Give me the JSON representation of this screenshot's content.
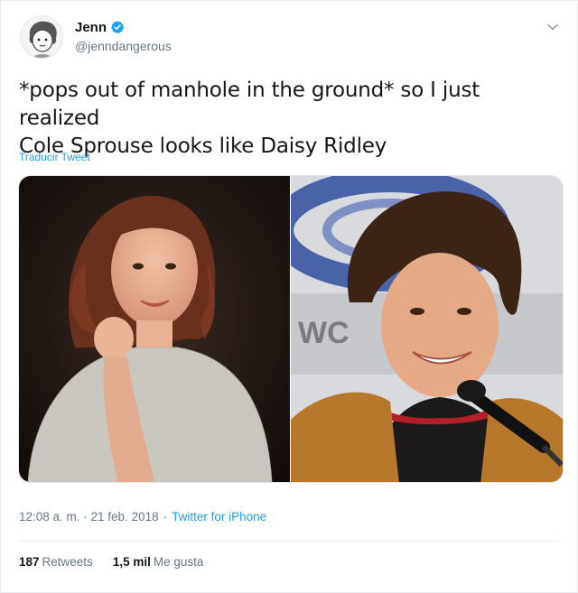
{
  "tweet": {
    "author": {
      "name": "Jenn",
      "handle": "@jenndangerous",
      "verified": true,
      "avatar_icon": "cartoon-avatar-icon"
    },
    "menu_icon": "chevron-down-icon",
    "text_line1": "*pops out of manhole in the ground* so I just realized",
    "text_line2": "Cole Sprouse looks like Daisy Ridley",
    "translate_label": "Traducir Tweet",
    "media": [
      {
        "description_icon": "photo-woman-icon"
      },
      {
        "description_icon": "photo-man-microphone-icon"
      }
    ],
    "timestamp": "12:08 a. m. · 21 feb. 2018",
    "separator": "·",
    "source": "Twitter for iPhone",
    "stats": {
      "retweets_count": "187",
      "retweets_label": "Retweets",
      "likes_count": "1,5 mil",
      "likes_label": "Me gusta"
    }
  },
  "colors": {
    "link": "#1da1f2",
    "muted": "#657786",
    "text": "#14171a",
    "border": "#e6ecf0"
  }
}
